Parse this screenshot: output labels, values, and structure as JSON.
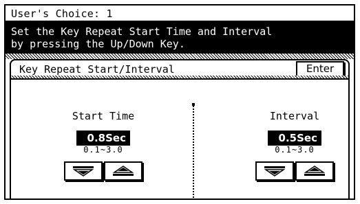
{
  "header": {
    "title": "User's Choice: 1"
  },
  "message": {
    "line1": "Set the Key Repeat Start Time and Interval",
    "line2": "by pressing the Up/Down Key."
  },
  "panel": {
    "title": "Key Repeat Start/Interval",
    "enter_label": "Enter"
  },
  "start_time": {
    "label": "Start Time",
    "value": "0.8Sec",
    "range": "0.1~3.0",
    "down_icon": "down-triangle-icon",
    "up_icon": "up-triangle-icon"
  },
  "interval": {
    "label": "Interval",
    "value": "0.5Sec",
    "range": "0.1~3.0",
    "down_icon": "down-triangle-icon",
    "up_icon": "up-triangle-icon"
  },
  "colors": {
    "background": "#ffffff",
    "foreground": "#000000"
  }
}
